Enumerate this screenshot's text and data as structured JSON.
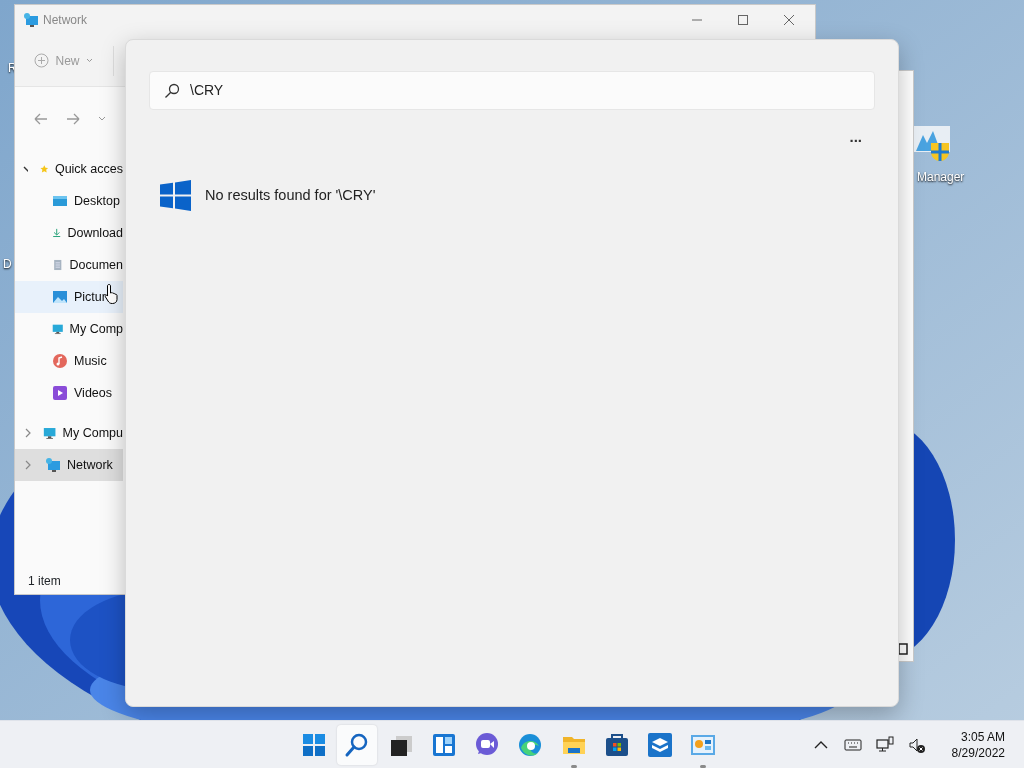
{
  "desktop_icons": [
    {
      "label": "R",
      "kind": "plain"
    },
    {
      "label": "D",
      "kind": "plain"
    },
    {
      "label": "Manager",
      "kind": "monitor"
    }
  ],
  "explorer": {
    "title": "Network",
    "new_button": "New",
    "sidebar": [
      {
        "label": "Quick acces",
        "expanded": true,
        "selected": false,
        "hovered": false,
        "children": [
          {
            "label": "Desktop",
            "selected": false,
            "hovered": false
          },
          {
            "label": "Download",
            "selected": false,
            "hovered": false
          },
          {
            "label": "Documen",
            "selected": false,
            "hovered": false
          },
          {
            "label": "Pictur",
            "selected": false,
            "hovered": true
          },
          {
            "label": "My Comp",
            "selected": false,
            "hovered": false
          },
          {
            "label": "Music",
            "selected": false,
            "hovered": false
          },
          {
            "label": "Videos",
            "selected": false,
            "hovered": false
          }
        ]
      },
      {
        "label": "My Compu",
        "expanded": false,
        "selected": false,
        "hovered": false
      },
      {
        "label": "Network",
        "expanded": false,
        "selected": true,
        "hovered": false
      }
    ],
    "status_bar": "1 item"
  },
  "search": {
    "query": "\\CRY",
    "more_button": "...",
    "message": "No results found for '\\CRY'"
  },
  "taskbar": {
    "apps": [
      {
        "kind": "start",
        "selected": false,
        "running": false
      },
      {
        "kind": "search",
        "selected": true,
        "running": false
      },
      {
        "kind": "taskview",
        "selected": false,
        "running": false
      },
      {
        "kind": "widgets",
        "selected": false,
        "running": false
      },
      {
        "kind": "chat",
        "selected": false,
        "running": false
      },
      {
        "kind": "edge",
        "selected": false,
        "running": false
      },
      {
        "kind": "folder",
        "selected": false,
        "running": true
      },
      {
        "kind": "store",
        "selected": false,
        "running": false
      },
      {
        "kind": "box",
        "selected": false,
        "running": false
      },
      {
        "kind": "panel",
        "selected": false,
        "running": true
      }
    ],
    "tray": [
      {
        "kind": "chevron"
      },
      {
        "kind": "keyboard"
      },
      {
        "kind": "network"
      },
      {
        "kind": "volume-muted"
      }
    ],
    "time": "3:05 AM",
    "date": "8/29/2022"
  }
}
